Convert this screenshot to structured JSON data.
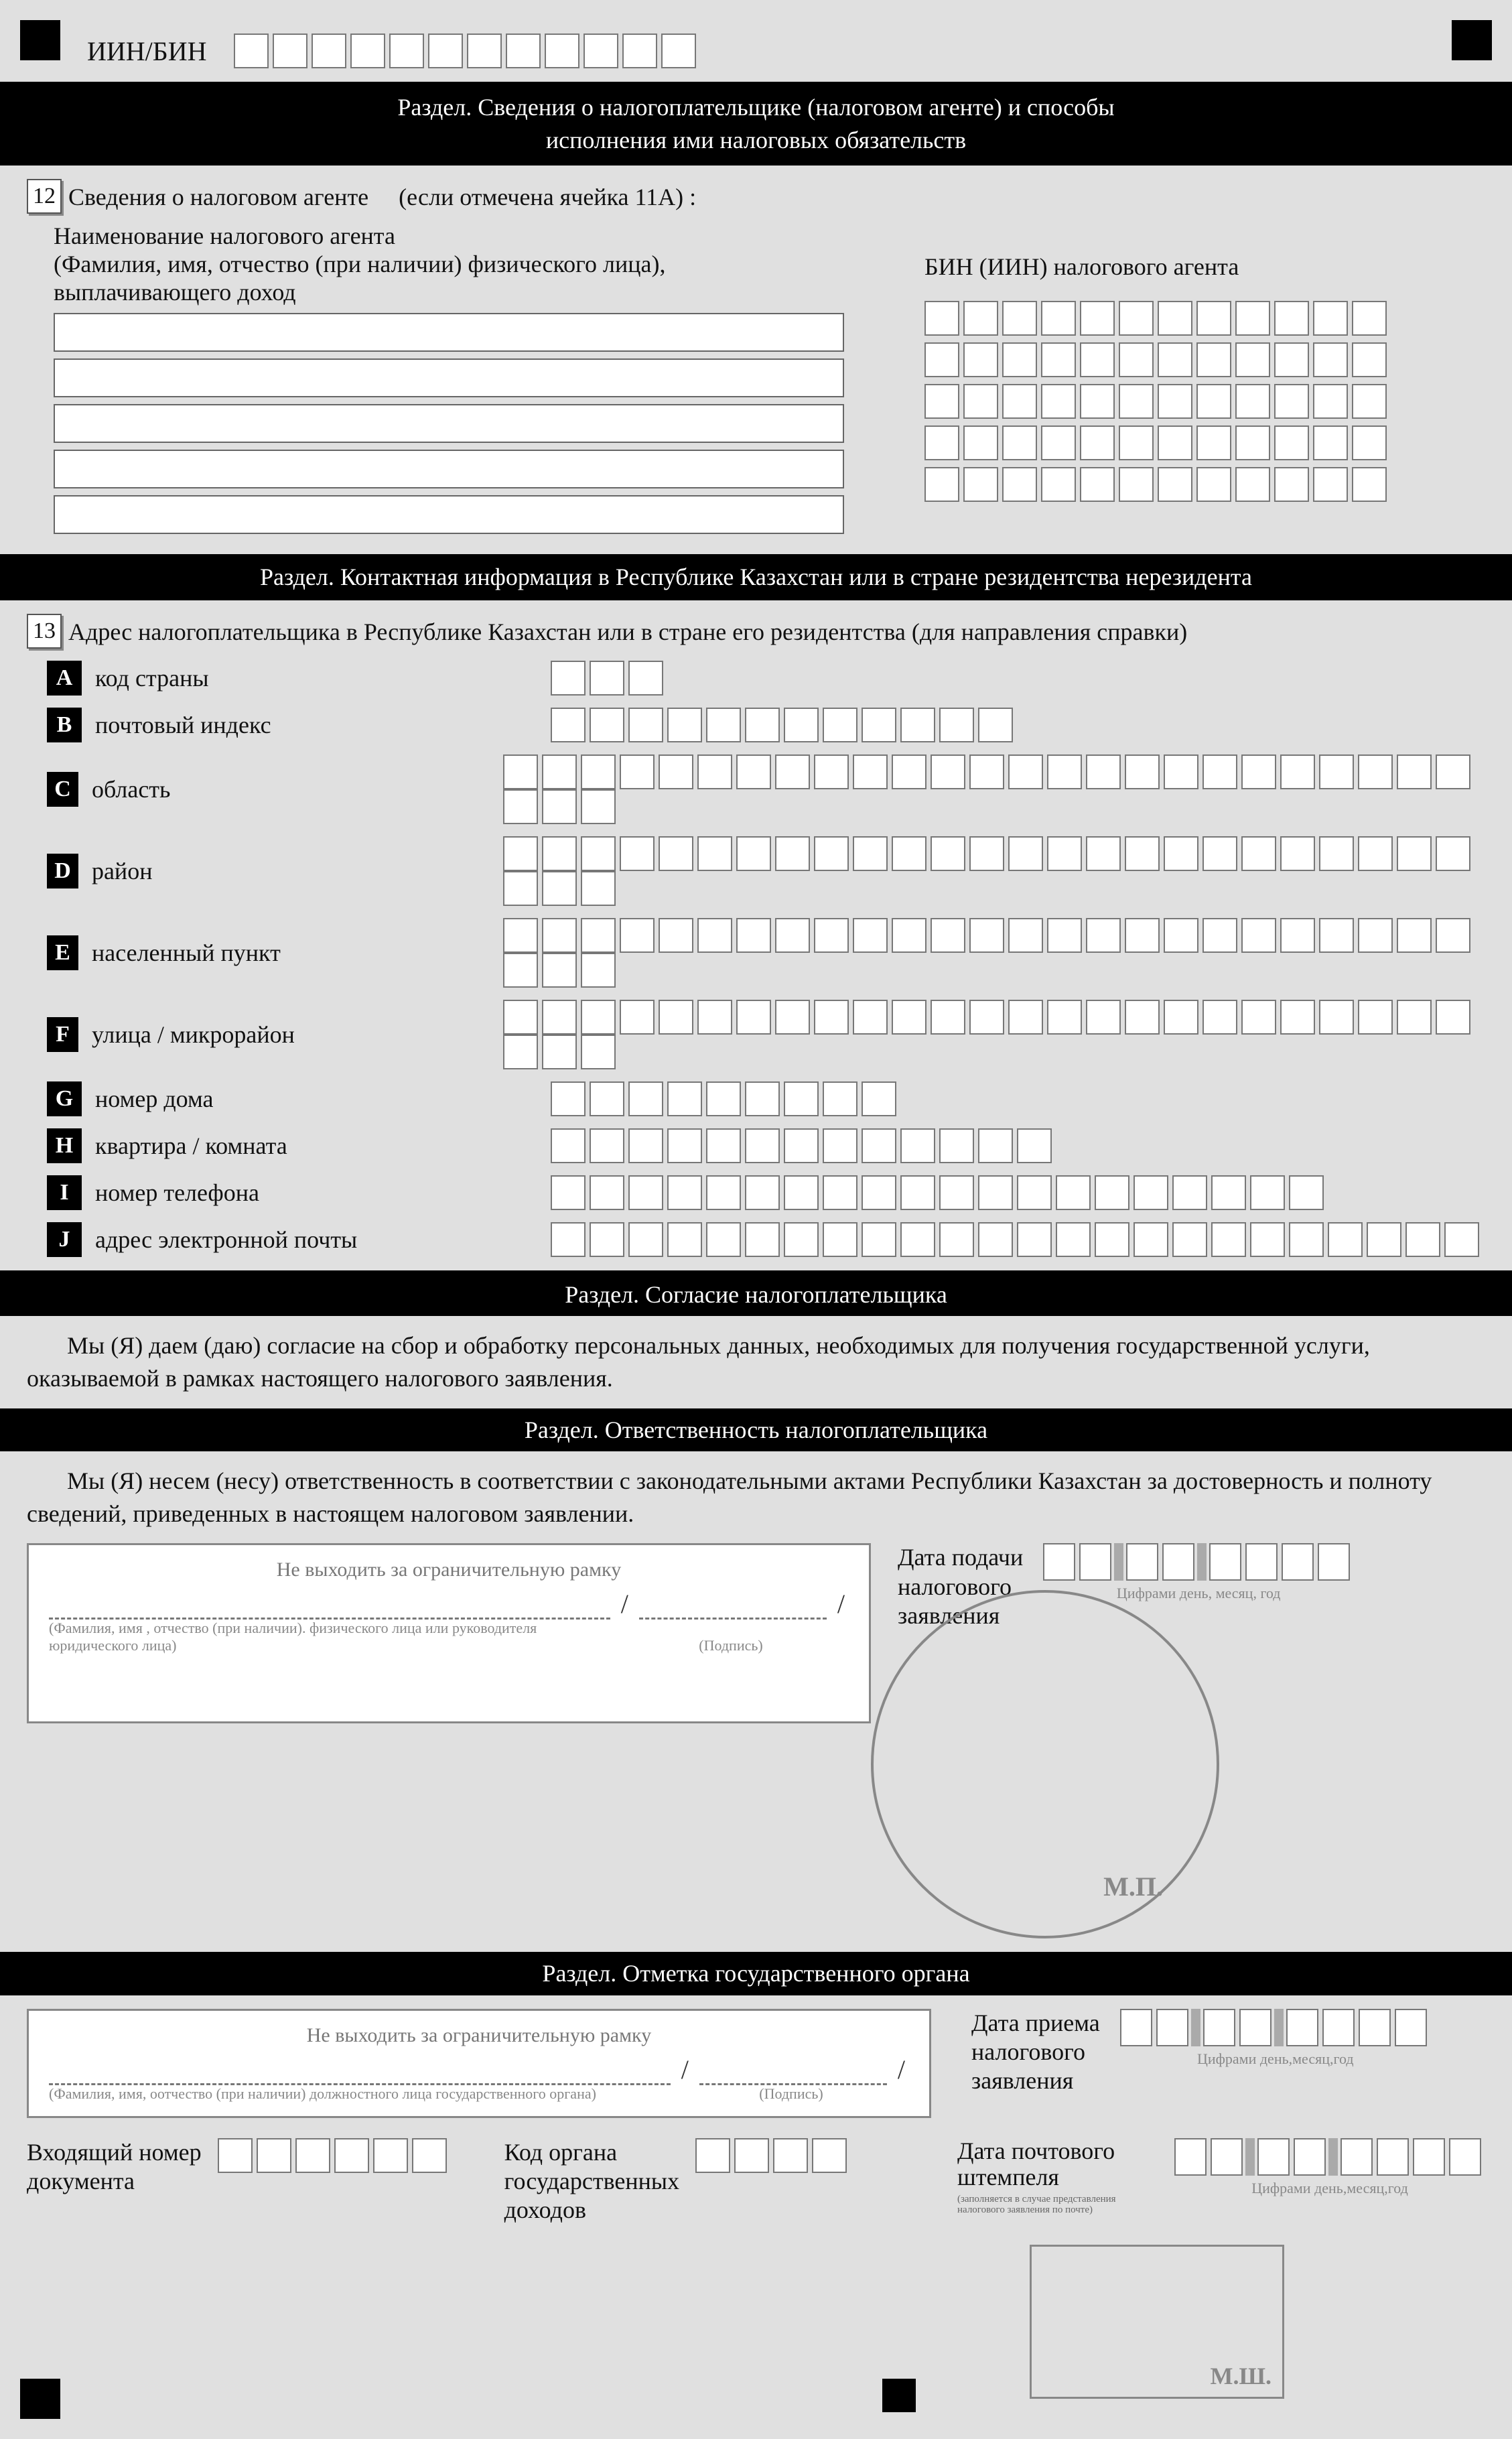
{
  "header": {
    "iin_label": "ИИН/БИН"
  },
  "section1": {
    "title_line1": "Раздел. Сведения о налогоплательщике (налоговом агенте) и способы",
    "title_line2": "исполнения ими налоговых обязательств"
  },
  "item12": {
    "number": "12",
    "title": "Сведения о налоговом агенте",
    "condition": "(если отмечена ячейка 11А)    :",
    "name_label_l1": "Наименование налогового агента",
    "name_label_l2": "(Фамилия, имя, отчество (при наличии) физического лица),",
    "name_label_l3": "выплачивающего доход",
    "bin_label": "БИН (ИИН) налогового агента"
  },
  "section2": {
    "title": "Раздел. Контактная информация в Республике Казахстан или в стране резидентства нерезидента"
  },
  "item13": {
    "number": "13",
    "title": "Адрес налогоплательщика в Республике Казахстан или в стране его резидентства (для направления справки)",
    "rows": {
      "A": "код страны",
      "B": "почтовый индекс",
      "C": "область",
      "D": "район",
      "E": "населенный пункт",
      "F": "улица / микрорайон",
      "G": "номер дома",
      "H": "квартира / комната",
      "I": "номер телефона",
      "J": "адрес электронной почты"
    }
  },
  "section_consent": {
    "title": "Раздел. Согласие налогоплательщика",
    "text": "Мы (Я) даем (даю) согласие на сбор и обработку персональных данных, необходимых для получения государственной услуги, оказываемой в рамках настоящего налогового заявления."
  },
  "section_resp": {
    "title": "Раздел. Ответственность налогоплательщика",
    "text": "Мы (Я) несем (несу) ответственность в соответствии с законодательными актами Республики Казахстан за достоверность и полноту сведений, приведенных в настоящем налоговом заявлении.",
    "frame_hint": "Не выходить за ограничительную рамку",
    "fio_hint": "(Фамилия, имя , отчество (при наличии). физического лица или руководителя юридического лица)",
    "sign_hint": "(Подпись)",
    "date_label_l1": "Дата подачи",
    "date_label_l2": "налогового",
    "date_label_l3": "заявления",
    "date_hint": "Цифрами день, месяц, год",
    "stamp": "М.П."
  },
  "section_gov": {
    "title": "Раздел. Отметка государственного органа",
    "frame_hint": "Не выходить за ограничительную рамку",
    "fio_hint": "(Фамилия, имя, оотчество (при наличии) должностного лица государственного органа)",
    "sign_hint": "(Подпись)",
    "date_recv_l1": "Дата приема",
    "date_recv_l2": "налогового",
    "date_recv_l3": "заявления",
    "date_hint1": "Цифрами день,месяц,год",
    "incoming_l1": "Входящий номер",
    "incoming_l2": "документа",
    "kod_l1": "Код органа",
    "kod_l2": "государственных",
    "kod_l3": "доходов",
    "post_l1": "Дата почтового",
    "post_l2": "штемпеля",
    "post_note": "(заполняется в случае представления налогового заявления по почте)",
    "date_hint2": "Цифрами день,месяц,год",
    "stamp": "М.Ш."
  }
}
